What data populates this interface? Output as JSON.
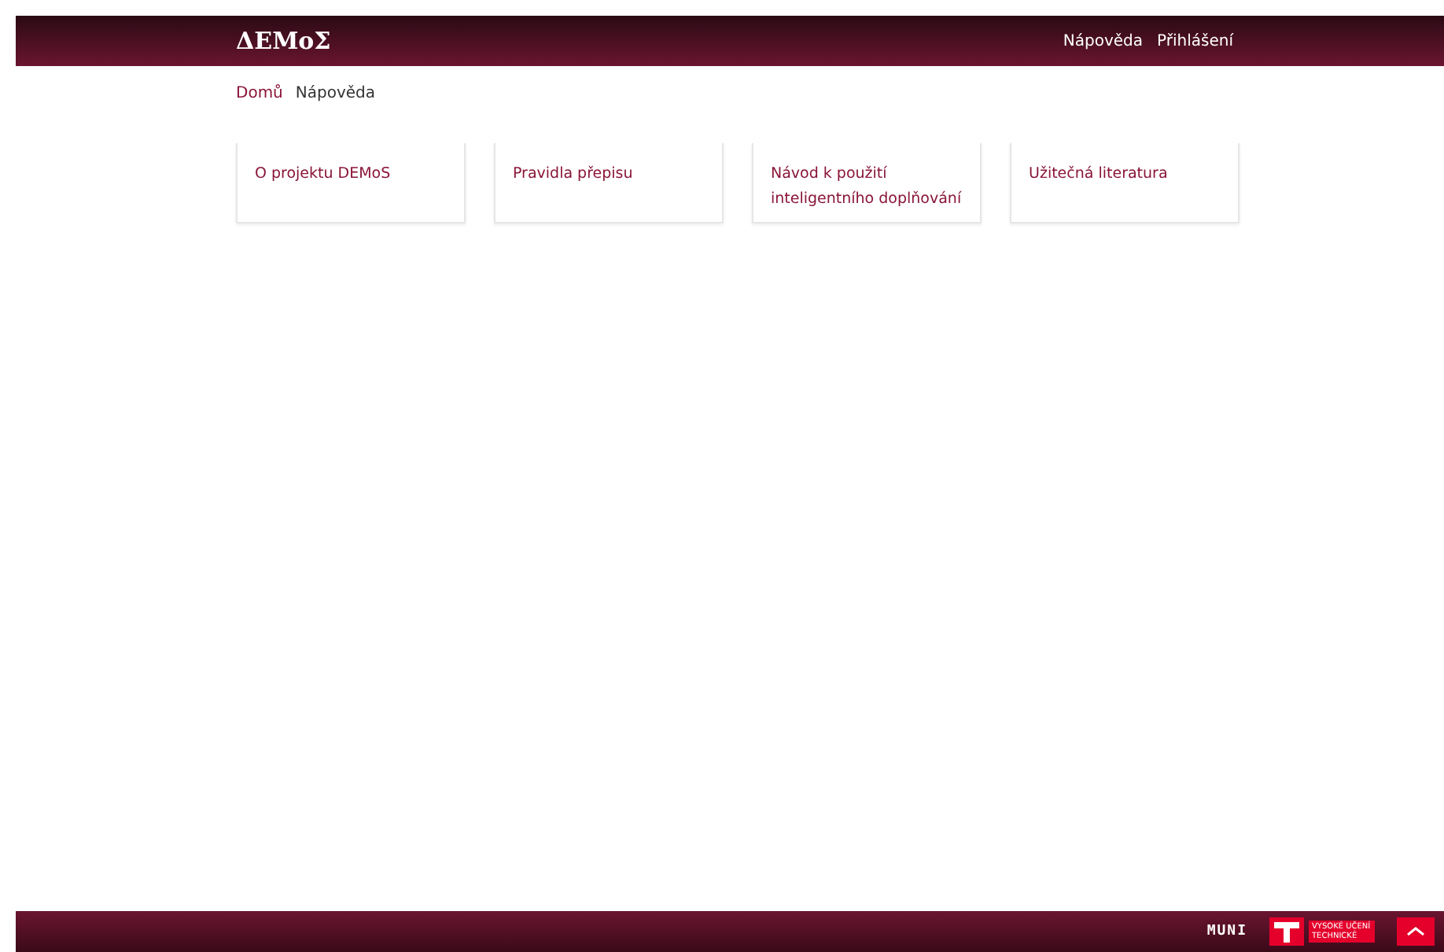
{
  "header": {
    "logo": "ΔEMoΣ",
    "links": [
      {
        "label": "Nápověda"
      },
      {
        "label": "Přihlášení"
      }
    ]
  },
  "breadcrumbs": [
    {
      "label": "Domů",
      "current": false
    },
    {
      "label": "Nápověda",
      "current": true
    }
  ],
  "cards": [
    {
      "title": "O projektu DEMoS"
    },
    {
      "title": "Pravidla přepisu"
    },
    {
      "title": "Návod k použití inteligentního doplňování"
    },
    {
      "title": "Užitečná literatura"
    }
  ],
  "footer": {
    "muni": "MUNI",
    "vut": "VYSOKÉ UČENÍ TECHNICKÉ"
  }
}
